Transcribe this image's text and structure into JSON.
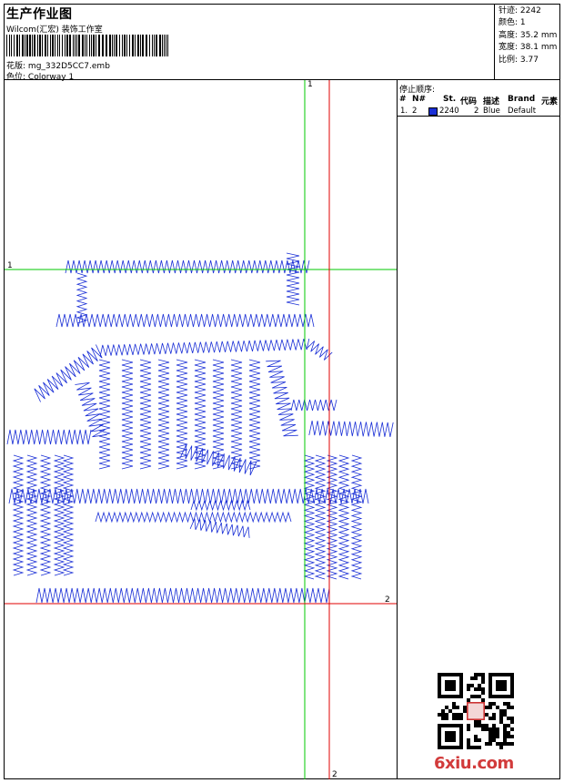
{
  "header": {
    "title": "生产作业图",
    "company": "Wilcom(汇宏) 装饰工作室",
    "design_label": "花版:",
    "design_value": "mg_332D5CC7.emb",
    "colorway_label": "色位:",
    "colorway_value": "Colorway 1"
  },
  "stats": [
    {
      "label": "针迹:",
      "value": "2242"
    },
    {
      "label": "颜色:",
      "value": "1"
    },
    {
      "label": "高度:",
      "value": "35.2 mm"
    },
    {
      "label": "宽度:",
      "value": "38.1 mm"
    },
    {
      "label": "比例:",
      "value": "3.77"
    }
  ],
  "stop_sequence": {
    "title": "停止顺序:",
    "columns": [
      "#",
      "N#",
      "St.",
      "代码",
      "描述",
      "Brand",
      "元素"
    ],
    "rows": [
      {
        "index": "1.",
        "needle": "2",
        "stitches": "2240",
        "code": "2",
        "description": "Blue",
        "brand": "Default",
        "color": "#1a2fd6"
      }
    ]
  },
  "guides": {
    "green_top": "1",
    "green_left": "1",
    "red_right": "2",
    "red_bottom": "2"
  },
  "watermark": {
    "site": "6xiu.com"
  },
  "colors": {
    "stitch": "#1a2fd6",
    "green_guide": "#00c800",
    "red_guide": "#e00000"
  }
}
